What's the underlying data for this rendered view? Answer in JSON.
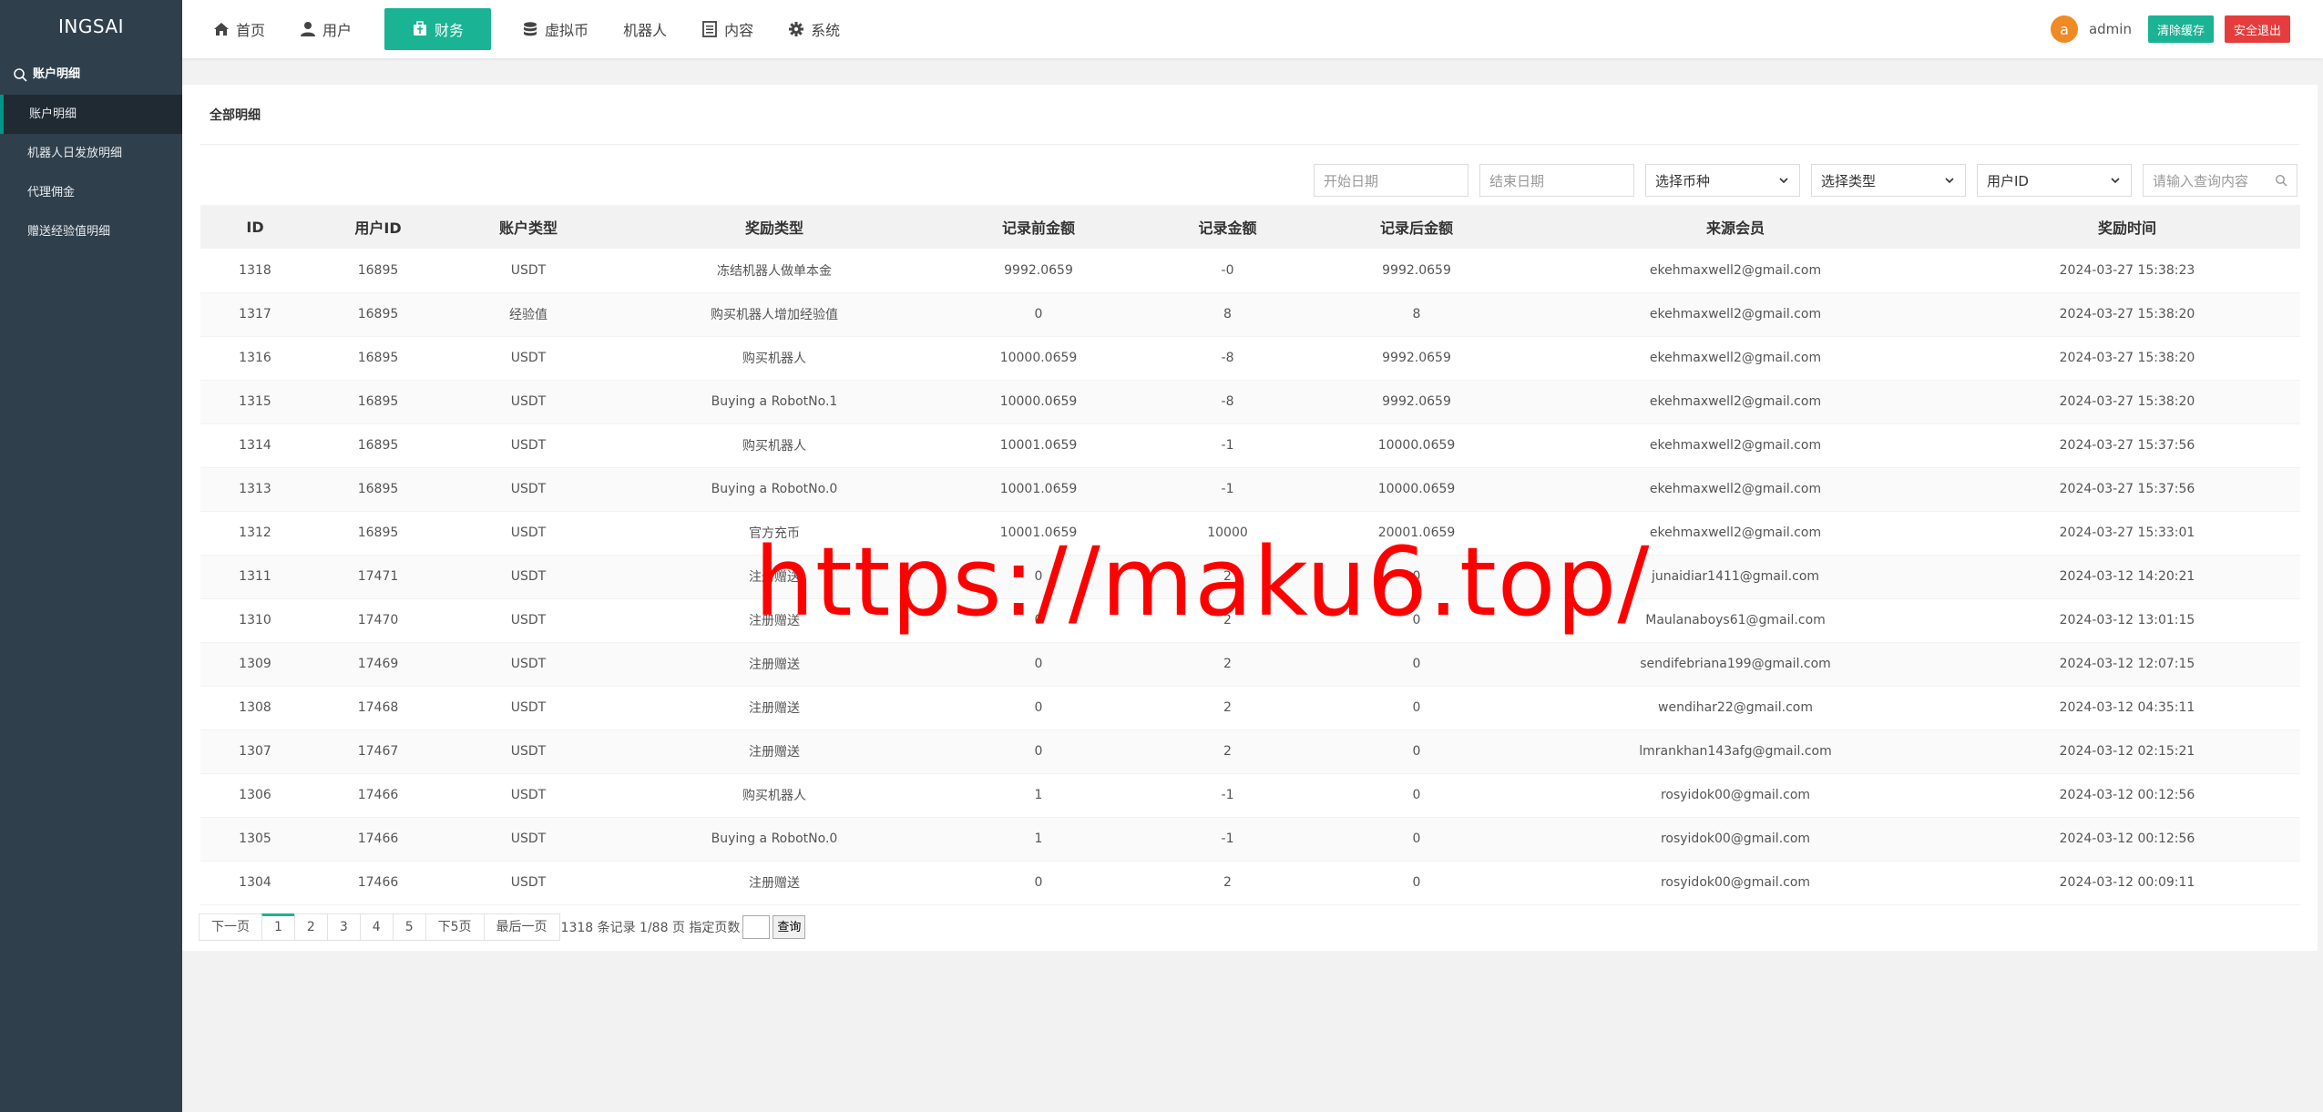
{
  "app": {
    "logo": "INGSAI"
  },
  "sidebar": {
    "section_title": "账户明细",
    "items": [
      {
        "label": "账户明细",
        "active": true
      },
      {
        "label": "机器人日发放明细"
      },
      {
        "label": "代理佣金"
      },
      {
        "label": "赠送经验值明细"
      }
    ]
  },
  "nav": [
    {
      "label": "首页",
      "icon": "home-icon"
    },
    {
      "label": "用户",
      "icon": "user-icon"
    },
    {
      "label": "财务",
      "icon": "finance-icon",
      "active": true
    },
    {
      "label": "虚拟币",
      "icon": "database-icon"
    },
    {
      "label": "机器人",
      "icon": ""
    },
    {
      "label": "内容",
      "icon": "document-icon"
    },
    {
      "label": "系统",
      "icon": "gear-icon"
    }
  ],
  "header": {
    "avatar_letter": "a",
    "username": "admin",
    "clear_cache": "清除缓存",
    "logout": "安全退出"
  },
  "panel": {
    "title": "全部明细"
  },
  "filters": {
    "start_date": "开始日期",
    "end_date": "结束日期",
    "currency": "选择币种",
    "type": "选择类型",
    "field": "用户ID",
    "search": "请输入查询内容"
  },
  "table": {
    "headers": [
      "ID",
      "用户ID",
      "账户类型",
      "奖励类型",
      "记录前金额",
      "记录金额",
      "记录后金额",
      "来源会员",
      "奖励时间"
    ],
    "rows": [
      [
        "1318",
        "16895",
        "USDT",
        "冻结机器人做单本金",
        "9992.0659",
        "-0",
        "9992.0659",
        "ekehmaxwell2@gmail.com",
        "2024-03-27 15:38:23"
      ],
      [
        "1317",
        "16895",
        "经验值",
        "购买机器人增加经验值",
        "0",
        "8",
        "8",
        "ekehmaxwell2@gmail.com",
        "2024-03-27 15:38:20"
      ],
      [
        "1316",
        "16895",
        "USDT",
        "购买机器人",
        "10000.0659",
        "-8",
        "9992.0659",
        "ekehmaxwell2@gmail.com",
        "2024-03-27 15:38:20"
      ],
      [
        "1315",
        "16895",
        "USDT",
        "Buying a RobotNo.1",
        "10000.0659",
        "-8",
        "9992.0659",
        "ekehmaxwell2@gmail.com",
        "2024-03-27 15:38:20"
      ],
      [
        "1314",
        "16895",
        "USDT",
        "购买机器人",
        "10001.0659",
        "-1",
        "10000.0659",
        "ekehmaxwell2@gmail.com",
        "2024-03-27 15:37:56"
      ],
      [
        "1313",
        "16895",
        "USDT",
        "Buying a RobotNo.0",
        "10001.0659",
        "-1",
        "10000.0659",
        "ekehmaxwell2@gmail.com",
        "2024-03-27 15:37:56"
      ],
      [
        "1312",
        "16895",
        "USDT",
        "官方充币",
        "10001.0659",
        "10000",
        "20001.0659",
        "ekehmaxwell2@gmail.com",
        "2024-03-27 15:33:01"
      ],
      [
        "1311",
        "17471",
        "USDT",
        "注册赠送",
        "0",
        "2",
        "0",
        "junaidiar1411@gmail.com",
        "2024-03-12 14:20:21"
      ],
      [
        "1310",
        "17470",
        "USDT",
        "注册赠送",
        "0",
        "2",
        "0",
        "Maulanaboys61@gmail.com",
        "2024-03-12 13:01:15"
      ],
      [
        "1309",
        "17469",
        "USDT",
        "注册赠送",
        "0",
        "2",
        "0",
        "sendifebriana199@gmail.com",
        "2024-03-12 12:07:15"
      ],
      [
        "1308",
        "17468",
        "USDT",
        "注册赠送",
        "0",
        "2",
        "0",
        "wendihar22@gmail.com",
        "2024-03-12 04:35:11"
      ],
      [
        "1307",
        "17467",
        "USDT",
        "注册赠送",
        "0",
        "2",
        "0",
        "lmrankhan143afg@gmail.com",
        "2024-03-12 02:15:21"
      ],
      [
        "1306",
        "17466",
        "USDT",
        "购买机器人",
        "1",
        "-1",
        "0",
        "rosyidok00@gmail.com",
        "2024-03-12 00:12:56"
      ],
      [
        "1305",
        "17466",
        "USDT",
        "Buying a RobotNo.0",
        "1",
        "-1",
        "0",
        "rosyidok00@gmail.com",
        "2024-03-12 00:12:56"
      ],
      [
        "1304",
        "17466",
        "USDT",
        "注册赠送",
        "0",
        "2",
        "0",
        "rosyidok00@gmail.com",
        "2024-03-12 00:09:11"
      ]
    ]
  },
  "pager": {
    "prev": "下一页",
    "pages": [
      "1",
      "2",
      "3",
      "4",
      "5"
    ],
    "next5": "下5页",
    "last": "最后一页",
    "info": "1318 条记录 1/88 页 指定页数",
    "go": "查询"
  },
  "watermark": "https://maku6.top/",
  "colors": {
    "accent": "#1ab394",
    "sidebar": "#2f3f4c",
    "danger": "#e53d3d",
    "avatar": "#f08a24"
  }
}
